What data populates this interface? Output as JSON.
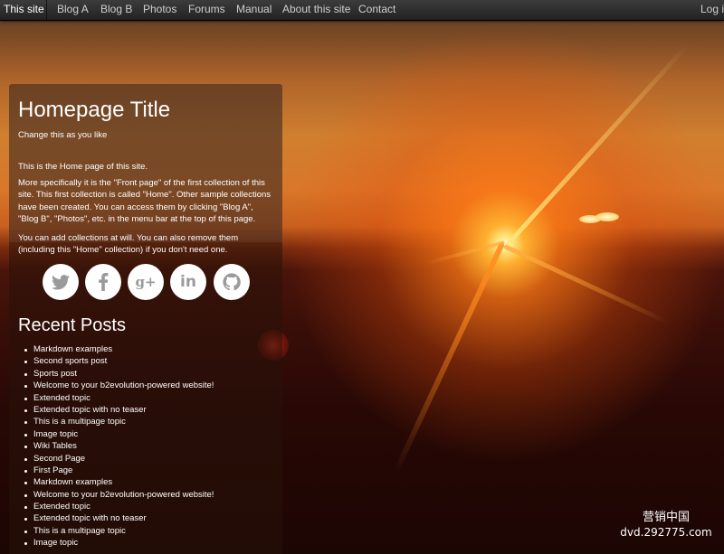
{
  "nav": {
    "site": "This site",
    "items": [
      "Blog A",
      "Blog B",
      "Photos",
      "Forums",
      "Manual",
      "About this site",
      "Contact"
    ],
    "login": "Log in"
  },
  "main": {
    "title": "Homepage Title",
    "subtitle": "Change this as you like",
    "para1": "This is the Home page of this site.",
    "para2": "More specifically it is the \"Front page\" of the first collection of this site. This first collection is called \"Home\". Other sample collections have been created. You can access them by clicking \"Blog A\", \"Blog B\", \"Photos\", etc. in the menu bar at the top of this page.",
    "para3": "You can add collections at will. You can also remove them (including this \"Home\" collection) if you don't need one."
  },
  "social": [
    "twitter-icon",
    "facebook-icon",
    "google-plus-icon",
    "linkedin-icon",
    "github-icon"
  ],
  "recent": {
    "heading": "Recent Posts",
    "posts": [
      "Markdown examples",
      "Second sports post",
      "Sports post",
      "Welcome to your b2evolution-powered website!",
      "Extended topic",
      "Extended topic with no teaser",
      "This is a multipage topic",
      "Image topic",
      "Wiki Tables",
      "Second Page",
      "First Page",
      "Markdown examples",
      "Welcome to your b2evolution-powered website!",
      "Extended topic",
      "Extended topic with no teaser",
      "This is a multipage topic",
      "Image topic"
    ]
  },
  "watermark": {
    "line1": "营销中国",
    "line2": "dvd.292775.com"
  }
}
